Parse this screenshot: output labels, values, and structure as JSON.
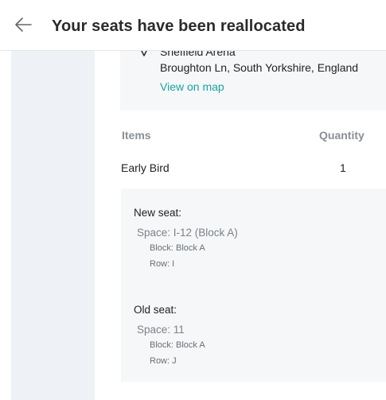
{
  "header": {
    "title": "Your seats have been reallocated"
  },
  "venue": {
    "name": "Sheffield Arena",
    "address": "Broughton Ln, South Yorkshire, England",
    "map_link": "View on map"
  },
  "items_table": {
    "columns": [
      "Items",
      "Quantity"
    ],
    "rows": [
      {
        "item": "Early Bird",
        "quantity": "1"
      }
    ]
  },
  "new_seat": {
    "heading": "New seat:",
    "space": "Space: I-12 (Block A)",
    "block": "Block: Block A",
    "row": "Row: I"
  },
  "old_seat": {
    "heading": "Old seat:",
    "space": "Space: 11",
    "block": "Block: Block A",
    "row": "Row: J"
  },
  "colors": {
    "link": "#1aa3a3",
    "sidebar": "#eef2f6",
    "card": "#f6f7f8",
    "muted_text": "#8a8f96"
  }
}
